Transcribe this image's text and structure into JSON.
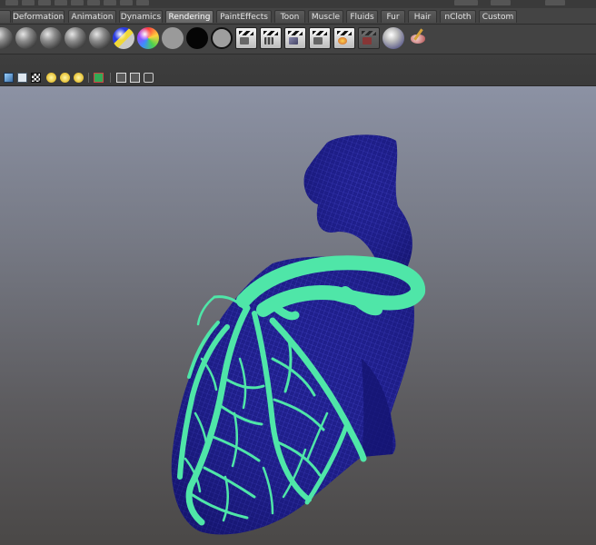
{
  "tabs": [
    {
      "label": "Deformation",
      "active": false
    },
    {
      "label": "Animation",
      "active": false
    },
    {
      "label": "Dynamics",
      "active": false
    },
    {
      "label": "Rendering",
      "active": true
    },
    {
      "label": "PaintEffects",
      "active": false
    },
    {
      "label": "Toon",
      "active": false
    },
    {
      "label": "Muscle",
      "active": false
    },
    {
      "label": "Fluids",
      "active": false
    },
    {
      "label": "Fur",
      "active": false
    },
    {
      "label": "Hair",
      "active": false
    },
    {
      "label": "nCloth",
      "active": false
    },
    {
      "label": "Custom",
      "active": false
    }
  ],
  "shelf_icons": [
    "sphere-shader-icon",
    "sphere-shader-icon",
    "sphere-shader-icon",
    "sphere-shader-icon",
    "sphere-shader-icon",
    "ramp-shader-icon",
    "rainbow-shader-icon",
    "grey-shader-icon",
    "black-shader-icon",
    "hollow-shader-icon",
    "render-view-icon",
    "render-icon",
    "ipr-render-icon",
    "render-settings-icon",
    "hypershade-icon",
    "batch-render-icon",
    "mental-ray-icon",
    "paint-icon"
  ],
  "viewport_icons": [
    "shaded-cube-icon",
    "wireframe-cube-icon",
    "textured-icon",
    "default-light-icon",
    "all-lights-icon",
    "light-icon",
    "isolate-select-icon",
    "xray-icon",
    "xray-joints-icon",
    "camera-icon"
  ],
  "colors": {
    "vessel_green": "#4fe6a8",
    "heart_blue": "#1e1e8a"
  }
}
